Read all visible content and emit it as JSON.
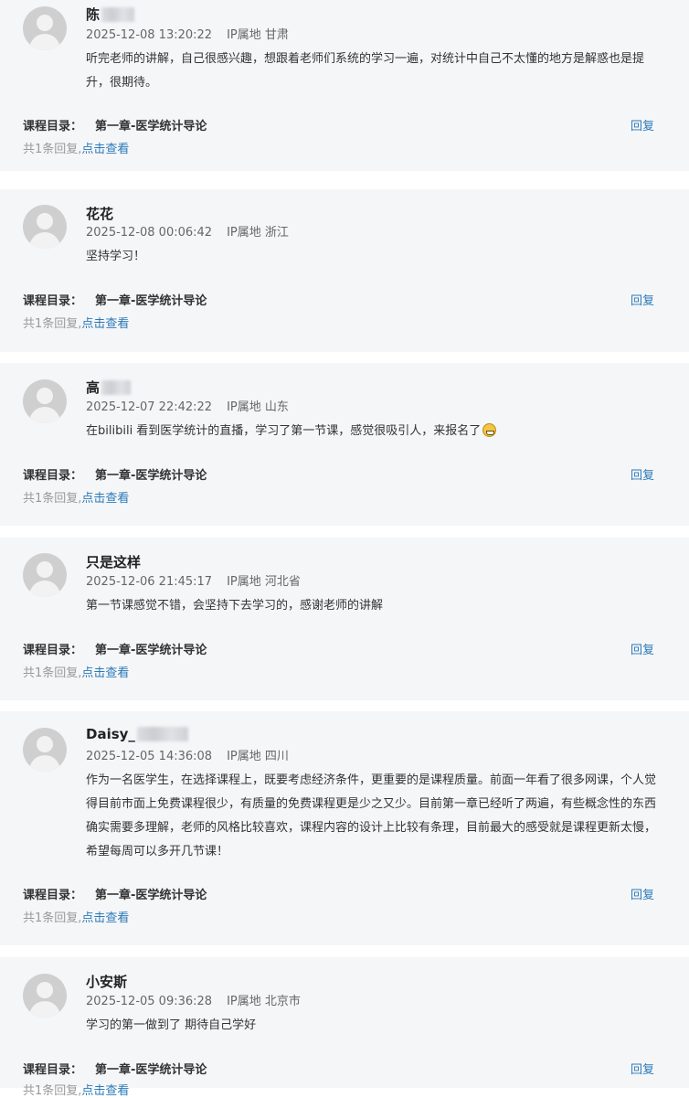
{
  "comments": [
    {
      "name": "陈",
      "time": "2025-12-08 13:20:22",
      "ip": "IP属地 甘肃",
      "content": "听完老师的讲解，自己很感兴趣，想跟着老师们系统的学习一遍，对统计中自己不太懂的地方是解惑也是提升，很期待。",
      "catalog_label": "课程目录：",
      "catalog_value": "第一章-医学统计导论",
      "reply_label": "回复",
      "reply_count": "共1条回复,",
      "view_link": "点击查看"
    },
    {
      "name": "花花",
      "time": "2025-12-08 00:06:42",
      "ip": "IP属地 浙江",
      "content": "坚持学习！",
      "catalog_label": "课程目录：",
      "catalog_value": "第一章-医学统计导论",
      "reply_label": "回复",
      "reply_count": "共1条回复,",
      "view_link": "点击查看"
    },
    {
      "name": "高",
      "time": "2025-12-07 22:42:22",
      "ip": "IP属地 山东",
      "content": "在bilibili 看到医学统计的直播，学习了第一节课，感觉很吸引人，来报名了",
      "emoji": "grinning-face-icon",
      "catalog_label": "课程目录：",
      "catalog_value": "第一章-医学统计导论",
      "reply_label": "回复",
      "reply_count": "共1条回复,",
      "view_link": "点击查看"
    },
    {
      "name": "只是这样",
      "time": "2025-12-06 21:45:17",
      "ip": "IP属地 河北省",
      "content": "第一节课感觉不错，会坚持下去学习的，感谢老师的讲解",
      "catalog_label": "课程目录：",
      "catalog_value": "第一章-医学统计导论",
      "reply_label": "回复",
      "reply_count": "共1条回复,",
      "view_link": "点击查看"
    },
    {
      "name": "Daisy_",
      "time": "2025-12-05 14:36:08",
      "ip": "IP属地 四川",
      "content": "作为一名医学生，在选择课程上，既要考虑经济条件，更重要的是课程质量。前面一年看了很多网课，个人觉得目前市面上免费课程很少，有质量的免费课程更是少之又少。目前第一章已经听了两遍，有些概念性的东西确实需要多理解，老师的风格比较喜欢，课程内容的设计上比较有条理，目前最大的感受就是课程更新太慢，希望每周可以多开几节课！",
      "catalog_label": "课程目录：",
      "catalog_value": "第一章-医学统计导论",
      "reply_label": "回复",
      "reply_count": "共1条回复,",
      "view_link": "点击查看"
    },
    {
      "name": "小安斯",
      "time": "2025-12-05 09:36:28",
      "ip": "IP属地 北京市",
      "content": "学习的第一做到了 期待自己学好",
      "catalog_label": "课程目录：",
      "catalog_value": "第一章-医学统计导论",
      "reply_label": "回复",
      "reply_count": "共1条回复,",
      "view_link": "点击查看"
    }
  ]
}
